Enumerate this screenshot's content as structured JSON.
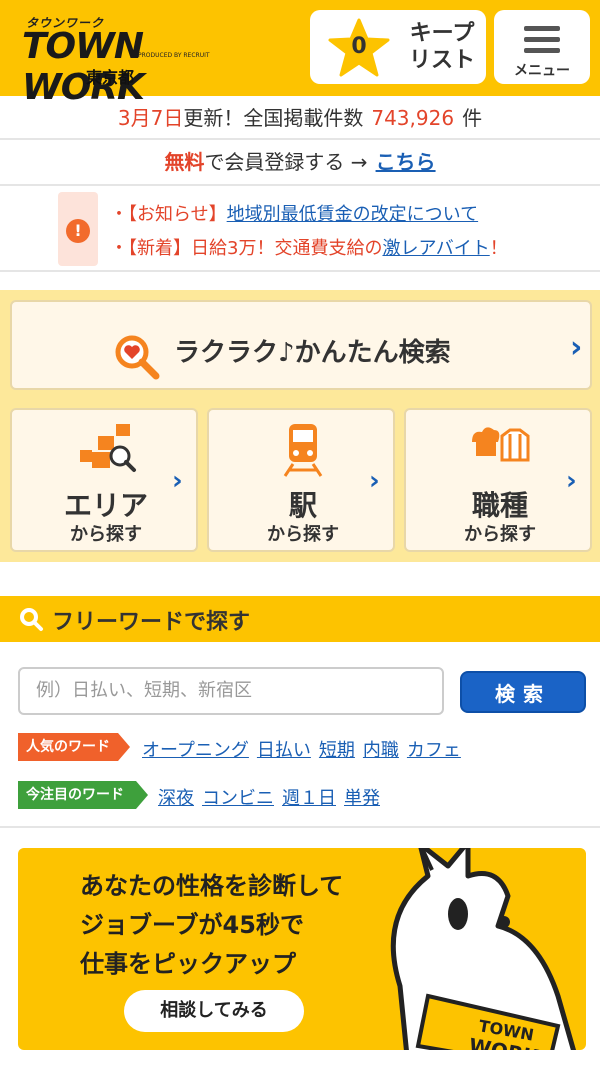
{
  "header": {
    "logo_kana": "タウンワーク",
    "logo_main": "TOWN WORK",
    "logo_produced": "PRODUCED BY RECRUIT",
    "region": "東京都",
    "keep": {
      "count": "0",
      "label_line1": "キープ",
      "label_line2": "リスト"
    },
    "menu_label": "メニュー"
  },
  "update": {
    "date": "3月7日",
    "text": "更新！全国掲載件数",
    "count": "743,926",
    "unit": "件"
  },
  "register": {
    "free": "無料",
    "text": "で会員登録する →",
    "link": "こちら"
  },
  "notices": [
    {
      "bullet": "・",
      "prefix": "【お知らせ】",
      "link": "地域別最低賃金の改定について",
      "suffix": ""
    },
    {
      "bullet": "・",
      "prefix": "【新着】日給3万！交通費支給の",
      "link": "激レアバイト",
      "suffix": "！"
    }
  ],
  "search": {
    "easy_label": "ラクラク♪かんたん検索",
    "categories": [
      {
        "big": "エリア",
        "small": "から探す",
        "icon": "map-area-icon"
      },
      {
        "big": "駅",
        "small": "から探す",
        "icon": "train-icon"
      },
      {
        "big": "職種",
        "small": "から探す",
        "icon": "uniform-icon"
      }
    ]
  },
  "freeword": {
    "title": "フリーワードで探す",
    "placeholder": "例）日払い、短期、新宿区",
    "button": "検索",
    "popular_tag": "人気のワード",
    "popular": [
      "オープニング",
      "日払い",
      "短期",
      "内職",
      "カフェ"
    ],
    "hot_tag": "今注目のワード",
    "hot": [
      "深夜",
      "コンビニ",
      "週１日",
      "単発"
    ]
  },
  "banner": {
    "line1": "あなたの性格を診断して",
    "line2": "ジョブーブが45秒で",
    "line3": "仕事をピックアップ",
    "button": "相談してみる",
    "sign_line1": "TOWN",
    "sign_line2": "WORK"
  },
  "colors": {
    "brand_yellow": "#fdc300",
    "accent_red": "#e3442a",
    "link_blue": "#1a5fb4",
    "search_blue": "#1a63c6"
  }
}
